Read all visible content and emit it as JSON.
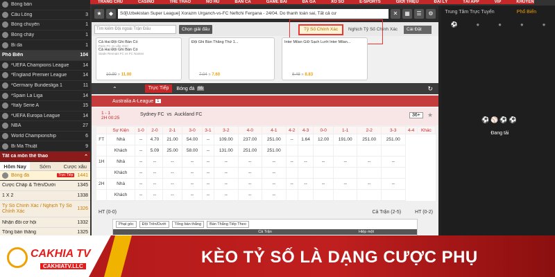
{
  "nav": [
    "TRANG CHỦ",
    "CASINO",
    "THỂ THAO",
    "NỔ HŨ",
    "BẮN CÁ",
    "GAME BÀI",
    "ĐÁ GÀ",
    "XỔ SỐ",
    "E-SPORTS",
    "GIỚI THIỆU",
    "ĐẠI LÝ",
    "TẢI APP",
    "VIP",
    "KHUYẾN MÃI"
  ],
  "sidebar": {
    "top_items": [
      {
        "label": "Bóng bàn",
        "count": ""
      },
      {
        "label": "Cầu Lông",
        "count": "3"
      },
      {
        "label": "Bóng chuyền",
        "count": "1"
      },
      {
        "label": "Bóng chày",
        "count": "1"
      },
      {
        "label": "Bi da",
        "count": "1"
      }
    ],
    "popular_title": "Phổ Biến",
    "popular_count": "104",
    "popular_items": [
      {
        "label": "*UEFA Champions League",
        "count": "14"
      },
      {
        "label": "*England Premier League",
        "count": "14"
      },
      {
        "label": "*Germany Bundesliga 1",
        "count": "11"
      },
      {
        "label": "*Spain La Liga",
        "count": "14"
      },
      {
        "label": "*Italy Serie A",
        "count": "15"
      },
      {
        "label": "*UEFA Europa League",
        "count": "14"
      },
      {
        "label": "NBA",
        "count": "27"
      },
      {
        "label": "World Championship",
        "count": "6"
      },
      {
        "label": "Bi Ma Thuật",
        "count": "9"
      }
    ],
    "all_title": "Tất cả môn thể thao",
    "tabs": [
      "Hôm Nay",
      "Sớm",
      "Cược xâu"
    ],
    "selected": {
      "label": "Bóng đá",
      "badge": "Trực Tiếp",
      "count": "1441"
    },
    "bet_items": [
      {
        "label": "Cược Chấp & Trên/Dưới",
        "count": "1345"
      },
      {
        "label": "1 X 2",
        "count": "1338"
      },
      {
        "label": "Tỷ Số Chính Xác / Nghịch Tỷ Số Chính Xác",
        "count": "1326"
      },
      {
        "label": "Nhận đôi cơ hội",
        "count": "1332"
      },
      {
        "label": "Tổng bàn thắng",
        "count": "1325"
      }
    ]
  },
  "ticker": "Số[Uzbekistan Super League] Xorazm Urganch-vs-FC Neftchi Fergana - 24/04. Do thanh toán sai, Tất cả cư",
  "search": {
    "placeholder": "Tìm kiếm Đội ngoài Trận Đấu",
    "button": "Chọn giải đấu"
  },
  "market_tabs": {
    "exact": "Tỷ Số Chính Xác",
    "reverse": "Nghịch Tỷ Số Chính Xác",
    "settings": "Cài Đặt"
  },
  "cards": [
    {
      "l1": "Cả Hai Đội Ghi Bàn Có",
      "l2": "Paris FC vs Lille OSC",
      "l3": "Cả Hai Đội Ghi Bàn Có",
      "l4": "Stade Rennais FC vs FC Nantes",
      "old": "10.90",
      "new": "11.00"
    },
    {
      "l1": "Đội Ghi Bàn Thắng Thứ 1...",
      "l2": "",
      "l3": "",
      "l4": "",
      "old": "7.04",
      "new": "7.60"
    },
    {
      "l1": "Inter Milan Giữ Sạch Lưới Inter Milan...",
      "l2": "",
      "l3": "",
      "l4": "",
      "old": "8.48",
      "new": "8.83"
    }
  ],
  "live": {
    "label": "Trực Tiếp",
    "sport": "Bóng đá",
    "count": "55"
  },
  "league": {
    "name": "Australia A-League",
    "count": "1"
  },
  "match": {
    "score": "1 - 1",
    "time": "2H 00:25",
    "home": "Sydney FC",
    "vs": "vs",
    "away": "Auckland FC",
    "markets": "36+"
  },
  "table": {
    "headers": [
      "Sự Kiện",
      "1-0",
      "2-0",
      "2-1",
      "3-0",
      "3-1",
      "3-2",
      "4-0",
      "4-1",
      "4-2",
      "4-3",
      "0-0",
      "1-1",
      "2-2",
      "3-3",
      "4-4",
      "Khác"
    ],
    "rows": [
      {
        "period": "FT",
        "side": "Nhà",
        "vals": [
          "--",
          "4.70",
          "21.00",
          "54.00",
          "--",
          "109.00",
          "237.00",
          "251.00",
          "--",
          "1.64",
          "12.00",
          "191.00",
          "251.00",
          "251.00"
        ]
      },
      {
        "period": "",
        "side": "Khách",
        "vals": [
          "--",
          "5.09",
          "25.00",
          "58.00",
          "--",
          "131.00",
          "251.00",
          "251.00",
          "",
          "",
          "",
          "",
          "",
          ""
        ]
      },
      {
        "period": "1H",
        "side": "Nhà",
        "vals": [
          "--",
          "--",
          "--",
          "--",
          "--",
          "--",
          "--",
          "--",
          "--",
          "--",
          "--",
          "--",
          "--",
          "--"
        ]
      },
      {
        "period": "",
        "side": "Khách",
        "vals": [
          "--",
          "--",
          "--",
          "--",
          "--",
          "--",
          "--",
          "--",
          "",
          "",
          "",
          "",
          "",
          ""
        ]
      },
      {
        "period": "2H",
        "side": "Nhà",
        "vals": [
          "--",
          "--",
          "--",
          "--",
          "--",
          "--",
          "--",
          "--",
          "--",
          "--",
          "--",
          "--",
          "--",
          "--"
        ]
      },
      {
        "period": "",
        "side": "Khách",
        "vals": [
          "--",
          "--",
          "--",
          "--",
          "--",
          "--",
          "--",
          "--",
          "",
          "",
          "",
          "",
          "",
          ""
        ]
      }
    ]
  },
  "ht": {
    "left": "HT (0-0)",
    "mid": "Cả Trận (2-5)",
    "right": "HT (0-2)"
  },
  "sub": {
    "chips": [
      "Phạt góc",
      "Đội Trên/Dưới",
      "Tổng bàn thắng",
      "Bàn Thắng Tiếp Theo"
    ],
    "heads": [
      "Cả Trận",
      "Hiệp một"
    ],
    "cols": [
      "Cược Chấp",
      "Trên/Dưới"
    ]
  },
  "right": {
    "tabs": [
      "Trung Tâm Trực Tuyến",
      "Phổ Biến"
    ],
    "loading": "Đang tải"
  },
  "banner": {
    "brand": "CAKHIA TV",
    "url": "CAKHIATV.LLC",
    "headline": "KÈO TỶ SỐ LÀ DẠNG CƯỢC PHỤ"
  },
  "colors": {
    "accent": "#c42828",
    "gold": "#f0a000"
  }
}
